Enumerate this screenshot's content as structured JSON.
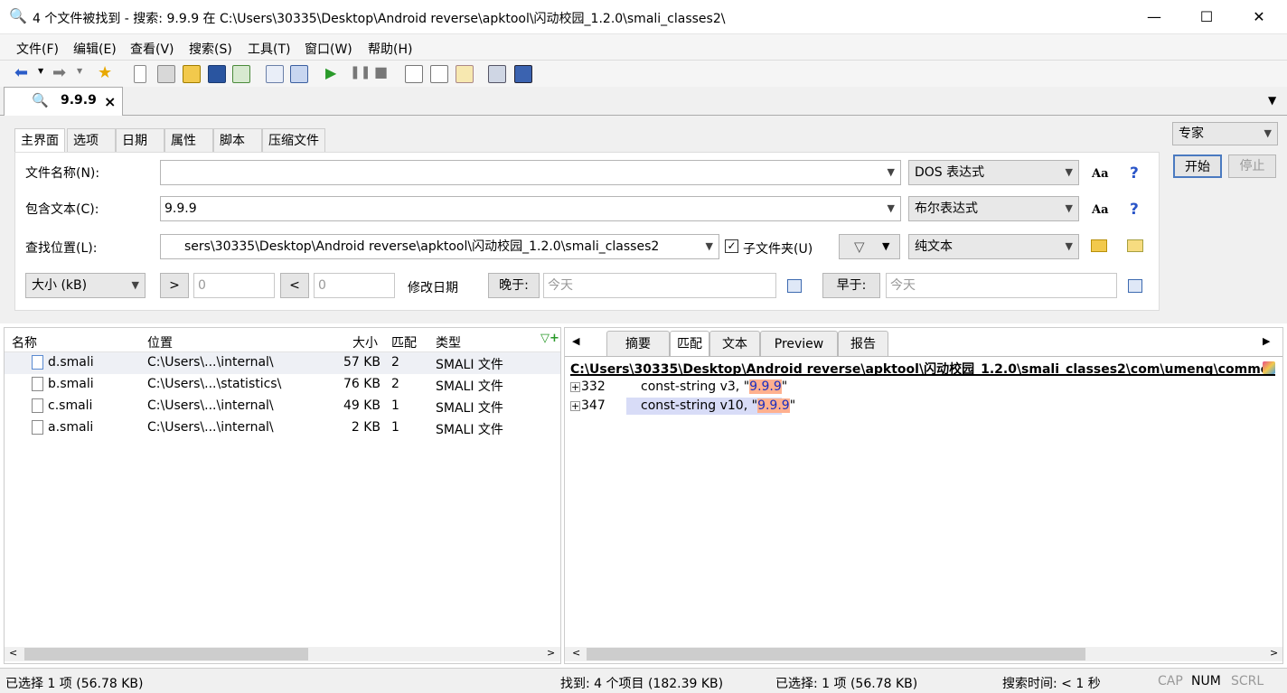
{
  "window": {
    "title": "4 个文件被找到 - 搜索: 9.9.9 在 C:\\Users\\30335\\Desktop\\Android reverse\\apktool\\闪动校园_1.2.0\\smali_classes2\\",
    "minimize": "—",
    "maximize": "☐",
    "close": "✕"
  },
  "menu": [
    "文件(F)",
    "编辑(E)",
    "查看(V)",
    "搜索(S)",
    "工具(T)",
    "窗口(W)",
    "帮助(H)"
  ],
  "doc_tab": {
    "label": "9.9.9",
    "close": "×"
  },
  "search_tabs": [
    "主界面",
    "选项",
    "日期",
    "属性",
    "脚本",
    "压缩文件"
  ],
  "form": {
    "filename_label": "文件名称(N):",
    "filename_value": "",
    "filename_mode": "DOS 表达式",
    "contains_label": "包含文本(C):",
    "contains_value": "9.9.9",
    "contains_mode": "布尔表达式",
    "location_label": "查找位置(L):",
    "location_value": "sers\\30335\\Desktop\\Android reverse\\apktool\\闪动校园_1.2.0\\smali_classes2",
    "subfolder_label": "子文件夹(U)",
    "subfolder_checked": true,
    "location_mode": "纯文本",
    "size_mode": "大小 (kB)",
    "gt_label": ">",
    "gt_value": "0",
    "lt_label": "<",
    "lt_value": "0",
    "modified_label": "修改日期",
    "later_label": "晚于:",
    "later_value": "今天",
    "earlier_label": "早于:",
    "earlier_value": "今天",
    "aa": "Aa",
    "help": "?"
  },
  "side": {
    "profile": "专家",
    "start": "开始",
    "stop": "停止"
  },
  "results": {
    "headers": {
      "name": "名称",
      "location": "位置",
      "size": "大小",
      "match": "匹配",
      "type": "类型"
    },
    "rows": [
      {
        "name": "d.smali",
        "location": "C:\\Users\\...\\internal\\",
        "size": "57 KB",
        "match": "2",
        "type": "SMALI 文件"
      },
      {
        "name": "b.smali",
        "location": "C:\\Users\\...\\statistics\\",
        "size": "76 KB",
        "match": "2",
        "type": "SMALI 文件"
      },
      {
        "name": "c.smali",
        "location": "C:\\Users\\...\\internal\\",
        "size": "49 KB",
        "match": "1",
        "type": "SMALI 文件"
      },
      {
        "name": "a.smali",
        "location": "C:\\Users\\...\\internal\\",
        "size": "2 KB",
        "match": "1",
        "type": "SMALI 文件"
      }
    ]
  },
  "preview": {
    "tabs": [
      "摘要",
      "匹配",
      "文本",
      "Preview",
      "报告"
    ],
    "active_tab": "匹配",
    "path": "C:\\Users\\30335\\Desktop\\Android reverse\\apktool\\闪动校园_1.2.0\\smali_classes2\\com\\umeng\\commonsdk\\inte",
    "matches": [
      {
        "line": "332",
        "prefix": "const-string v3, \"",
        "hit": "9.9.9",
        "suffix": "\""
      },
      {
        "line": "347",
        "prefix": "const-string v10, \"",
        "hit": "9.9.9",
        "suffix": "\""
      }
    ]
  },
  "status": {
    "selected": "已选择 1 项 (56.78 KB)",
    "found": "找到: 4 个项目 (182.39 KB)",
    "selected2": "已选择: 1 项 (56.78 KB)",
    "time": "搜索时间: < 1 秒",
    "cap": "CAP",
    "num": "NUM",
    "scrl": "SCRL"
  }
}
